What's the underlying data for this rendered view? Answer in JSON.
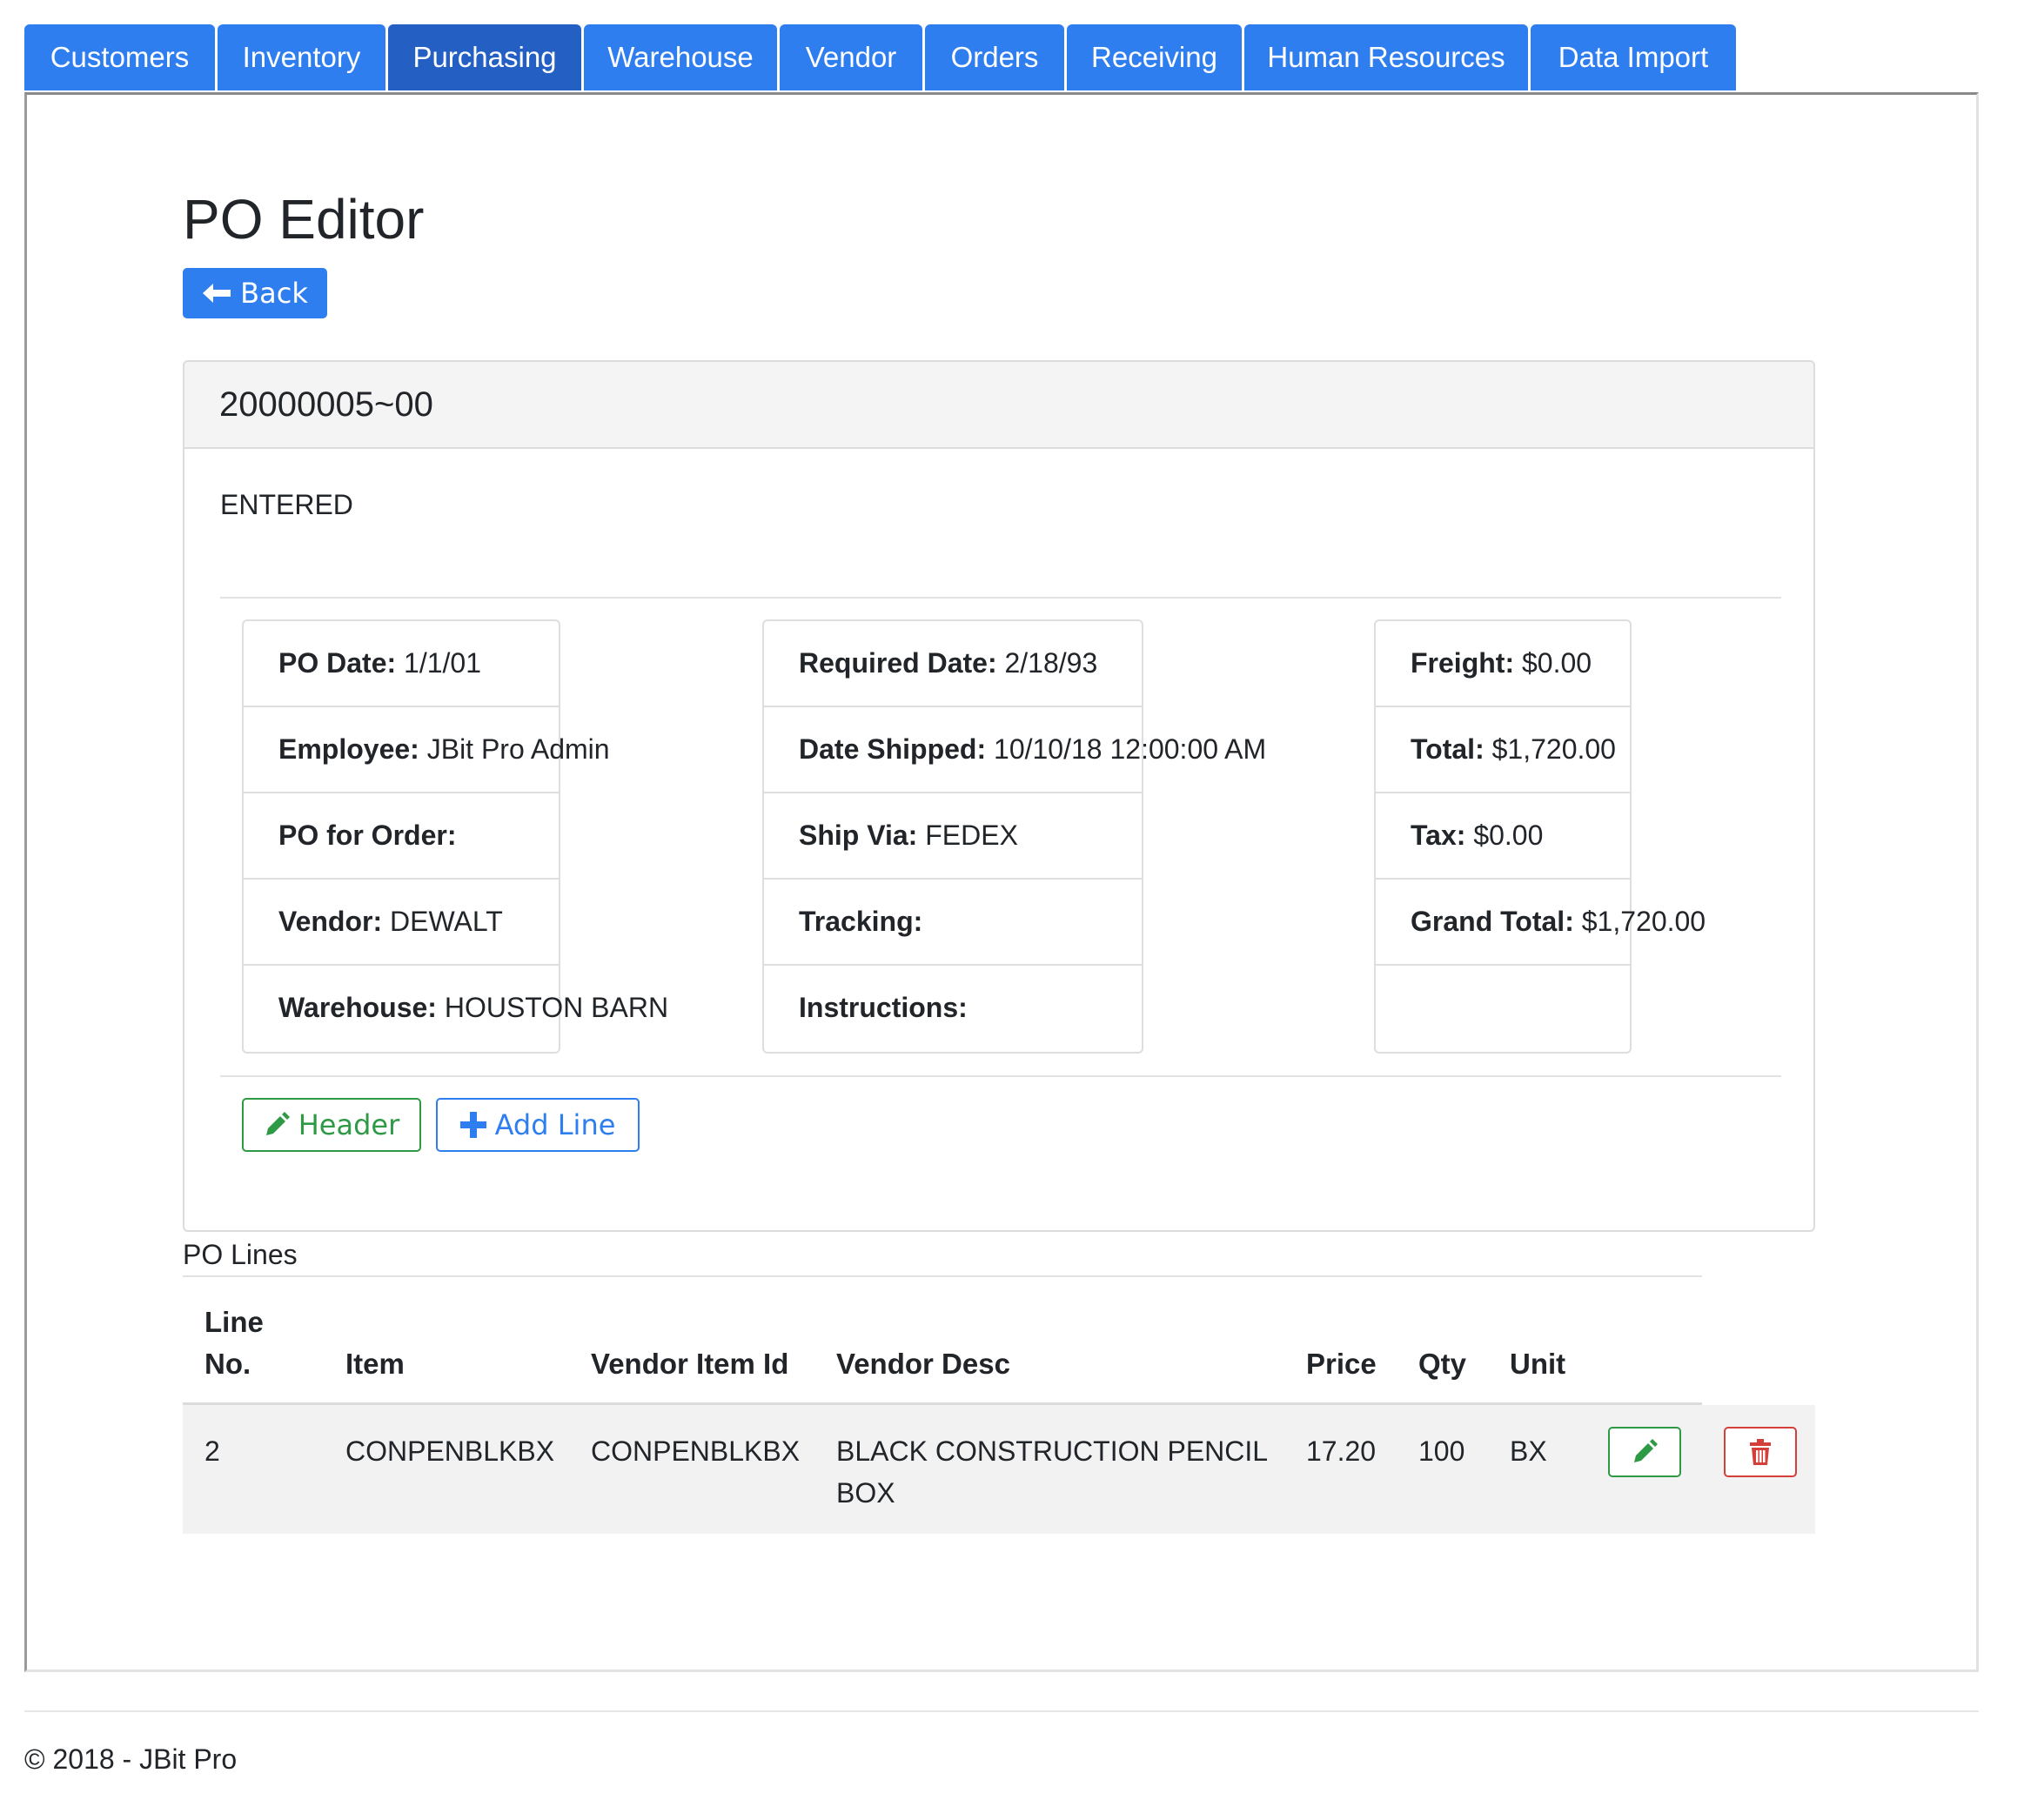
{
  "tabs": [
    {
      "label": "Customers",
      "active": false
    },
    {
      "label": "Inventory",
      "active": false
    },
    {
      "label": "Purchasing",
      "active": true
    },
    {
      "label": "Warehouse",
      "active": false
    },
    {
      "label": "Vendor",
      "active": false
    },
    {
      "label": "Orders",
      "active": false
    },
    {
      "label": "Receiving",
      "active": false
    },
    {
      "label": "Human Resources",
      "active": false
    },
    {
      "label": "Data Import",
      "active": false
    }
  ],
  "page": {
    "title": "PO Editor",
    "back_label": "Back"
  },
  "po": {
    "number": "20000005~00",
    "status": "ENTERED",
    "left": [
      {
        "label": "PO Date:",
        "value": "1/1/01"
      },
      {
        "label": "Employee:",
        "value": "JBit Pro Admin"
      },
      {
        "label": "PO for Order:",
        "value": ""
      },
      {
        "label": "Vendor:",
        "value": "DEWALT"
      },
      {
        "label": "Warehouse:",
        "value": "HOUSTON BARN"
      }
    ],
    "middle": [
      {
        "label": "Required Date:",
        "value": "2/18/93"
      },
      {
        "label": "Date Shipped:",
        "value": "10/10/18 12:00:00 AM"
      },
      {
        "label": "Ship Via:",
        "value": "FEDEX"
      },
      {
        "label": "Tracking:",
        "value": ""
      },
      {
        "label": "Instructions:",
        "value": ""
      }
    ],
    "right": [
      {
        "label": "Freight:",
        "value": "$0.00"
      },
      {
        "label": "Total:",
        "value": "$1,720.00"
      },
      {
        "label": "Tax:",
        "value": "$0.00"
      },
      {
        "label": "Grand Total:",
        "value": "$1,720.00"
      },
      {
        "label": "",
        "value": ""
      }
    ],
    "header_button_label": "Header",
    "add_line_button_label": "Add Line"
  },
  "lines": {
    "title": "PO Lines",
    "columns": {
      "line_no_1": "Line",
      "line_no_2": "No.",
      "item": "Item",
      "vendor_item_id": "Vendor Item Id",
      "vendor_desc": "Vendor Desc",
      "price": "Price",
      "qty": "Qty",
      "unit": "Unit"
    },
    "rows": [
      {
        "line_no": "2",
        "item": "CONPENBLKBX",
        "vendor_item_id": "CONPENBLKBX",
        "vendor_desc_1": "BLACK CONSTRUCTION PENCIL",
        "vendor_desc_2": "BOX",
        "price": "17.20",
        "qty": "100",
        "unit": "BX"
      }
    ]
  },
  "footer": {
    "text": "© 2018 - JBit Pro"
  },
  "colors": {
    "primary": "#2f7ef0",
    "primary_active": "#2460c4",
    "success": "#2f9a45",
    "danger": "#d43f3a"
  },
  "icons": {
    "back": "arrow-left-icon",
    "header": "pencil-icon",
    "add_line": "plus-icon",
    "row_edit": "pencil-icon",
    "row_delete": "trash-icon"
  }
}
